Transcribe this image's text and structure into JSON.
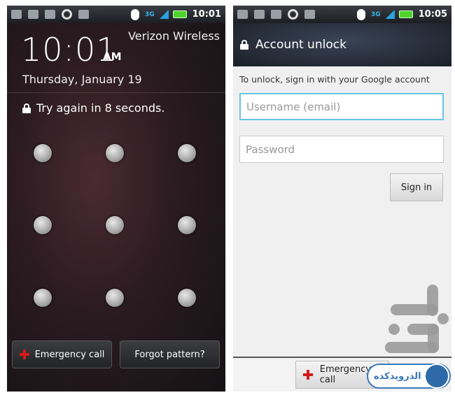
{
  "lock_screen": {
    "status_time": "10:01",
    "network": "3G",
    "clock": "10:01",
    "ampm": "AM",
    "carrier": "Verizon Wireless",
    "date": "Thursday, January 19",
    "message": "Try again in 8 seconds.",
    "emergency_label": "Emergency call",
    "forgot_label": "Forgot pattern?"
  },
  "account_unlock": {
    "status_time": "10:05",
    "network": "3G",
    "title": "Account unlock",
    "hint": "To unlock, sign in with your Google account",
    "username_placeholder": "Username (email)",
    "password_placeholder": "Password",
    "signin_label": "Sign in",
    "emergency_label": "Emergency call"
  },
  "watermark": {
    "text": "الدرویدکده"
  },
  "colors": {
    "focus_border": "#66c6e6",
    "emergency_cross": "#d21a1a",
    "battery": "#4fd22b"
  }
}
